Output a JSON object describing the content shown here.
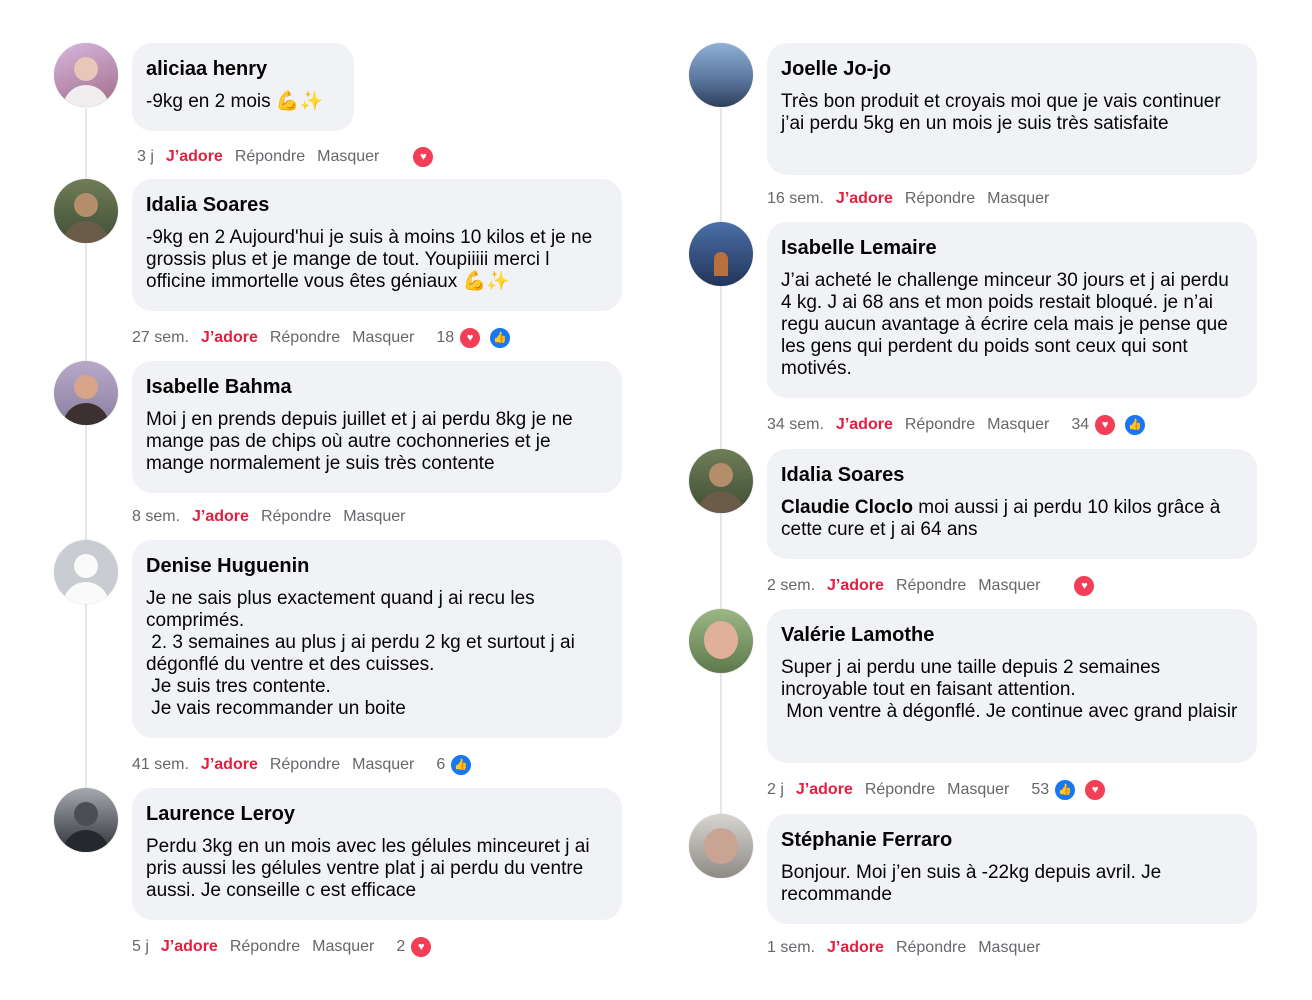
{
  "actions": {
    "like": "J’adore",
    "reply": "Répondre",
    "hide": "Masquer"
  },
  "colors": {
    "like_red": "#e41e3f",
    "meta_gray": "#65676b",
    "bubble_bg": "#f0f2f5",
    "heart": "#f33e58",
    "thumb": "#1877f2"
  },
  "left": [
    {
      "author": "aliciaa henry",
      "text": "-9kg en 2 mois 💪✨",
      "time": "3 j",
      "count": "",
      "reactions": [
        "heart-icon"
      ]
    },
    {
      "author": "Idalia Soares",
      "text": "-9kg en 2 Aujourd'hui je suis à moins 10 kilos et je ne grossis plus et je mange de tout. Youpiiiii merci l officine immortelle vous êtes géniaux 💪✨",
      "time": "27 sem.",
      "count": "18",
      "reactions": [
        "heart-icon",
        "thumb-icon"
      ]
    },
    {
      "author": "Isabelle Bahma",
      "text": "Moi j en prends depuis juillet et j ai perdu 8kg je ne mange pas de chips où autre cochonneries et je mange normalement je suis très contente",
      "time": "8 sem.",
      "count": "",
      "reactions": []
    },
    {
      "author": "Denise Huguenin",
      "text": "Je ne sais plus exactement quand j ai recu les comprimés.\n 2. 3 semaines au plus j ai perdu 2 kg et surtout j ai dégonflé du ventre et des cuisses.\n Je suis tres contente.\n Je vais recommander un boite",
      "time": "41 sem.",
      "count": "6",
      "reactions": [
        "thumb-icon"
      ]
    },
    {
      "author": "Laurence Leroy",
      "text": "Perdu 3kg en un mois avec les gélules minceuret j ai pris aussi les gélules ventre plat j ai perdu du ventre aussi. Je conseille c est efficace",
      "time": "5 j",
      "count": "2",
      "reactions": [
        "heart-icon"
      ]
    }
  ],
  "right": [
    {
      "author": "Joelle Jo-jo",
      "text": "Très bon produit et croyais moi que je vais continuer j’ai perdu 5kg en un mois je suis très satisfaite",
      "time": "16 sem.",
      "count": "",
      "reactions": []
    },
    {
      "author": "Isabelle Lemaire",
      "text": "J’ai acheté le challenge minceur 30 jours et j ai perdu 4 kg. J ai 68 ans et mon poids restait bloqué. je n’ai regu aucun avantage à écrire cela mais je pense que les gens qui perdent du poids sont ceux qui sont motivés.",
      "time": "34 sem.",
      "count": "34",
      "reactions": [
        "heart-icon",
        "thumb-icon"
      ]
    },
    {
      "author": "Idalia Soares",
      "mention": "Claudie Cloclo",
      "text": " moi aussi j ai perdu 10 kilos grâce à cette cure et j ai 64 ans",
      "time": "2 sem.",
      "count": "",
      "reactions": [
        "heart-icon"
      ]
    },
    {
      "author": "Valérie Lamothe",
      "text": "Super j ai perdu une taille depuis 2 semaines incroyable tout en faisant attention.\n Mon ventre à dégonflé. Je continue avec grand plaisir",
      "time": "2 j",
      "count": "53",
      "reactions": [
        "thumb-icon",
        "heart-icon"
      ]
    },
    {
      "author": "Stéphanie Ferraro",
      "text": "Bonjour. Moi j’en suis à -22kg depuis avril. Je recommande",
      "time": "1 sem.",
      "count": "",
      "reactions": []
    }
  ]
}
